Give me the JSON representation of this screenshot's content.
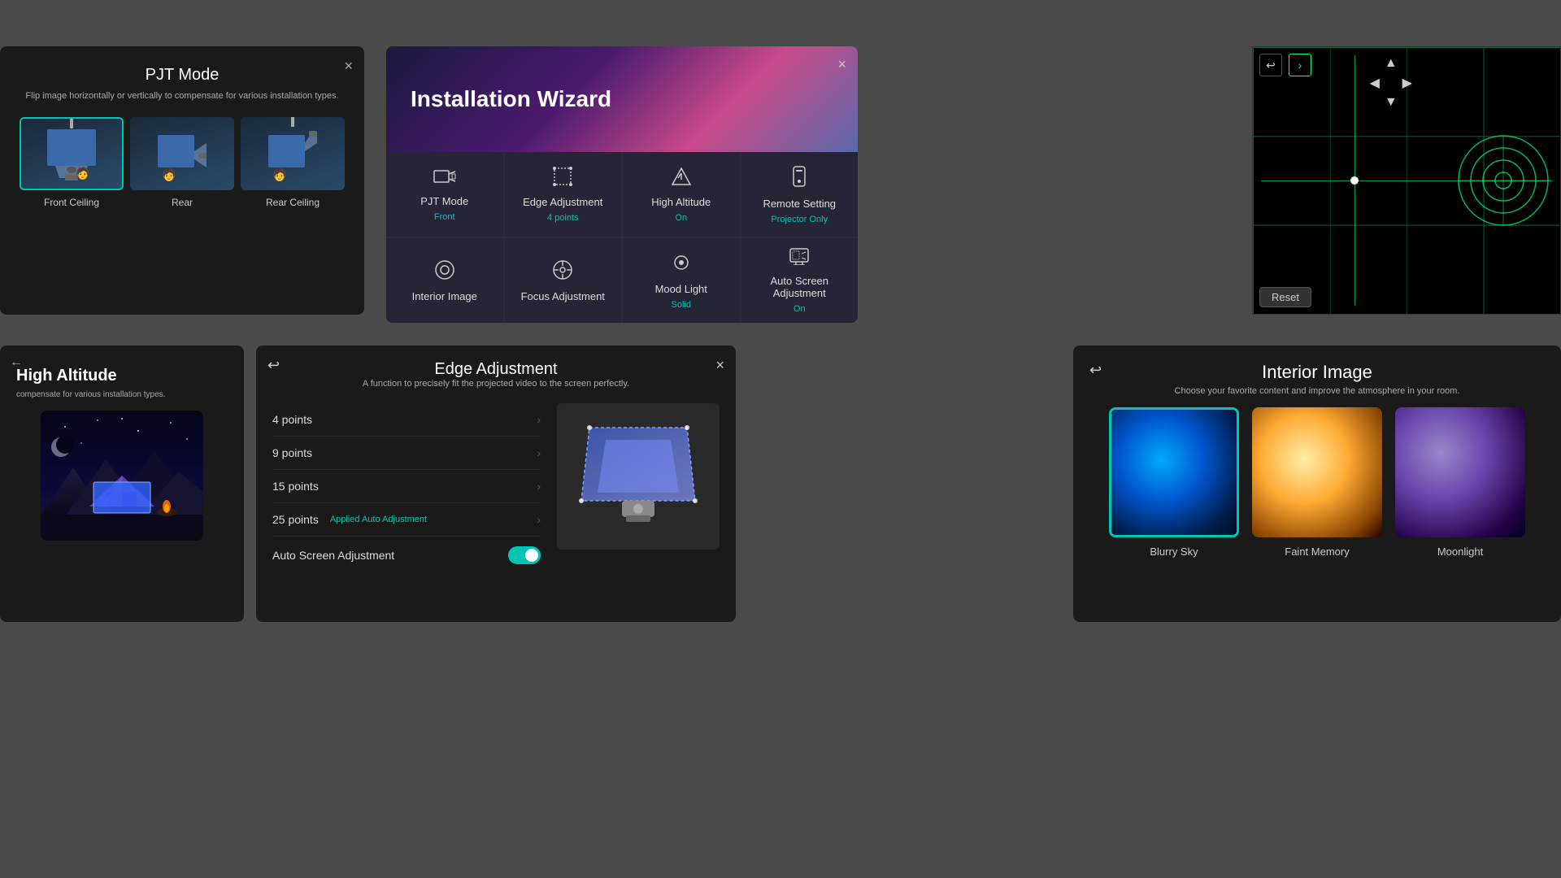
{
  "pjt": {
    "title": "PJT Mode",
    "subtitle": "Flip image horizontally or vertically to compensate for various installation types.",
    "modes": [
      {
        "id": "front-ceiling",
        "label": "Front Ceiling"
      },
      {
        "id": "rear",
        "label": "Rear"
      },
      {
        "id": "rear-ceiling",
        "label": "Rear Ceiling"
      }
    ],
    "close_label": "×"
  },
  "wizard": {
    "title": "Installation Wizard",
    "close_label": "×",
    "items": [
      {
        "id": "pjt-mode",
        "label": "PJT Mode",
        "sub": "Front",
        "icon": "⬜"
      },
      {
        "id": "edge-adjustment",
        "label": "Edge Adjustment",
        "sub": "4 points",
        "icon": "⧉"
      },
      {
        "id": "high-altitude",
        "label": "High Altitude",
        "sub": "On",
        "icon": "❄"
      },
      {
        "id": "remote-setting",
        "label": "Remote Setting",
        "sub": "Projector Only",
        "icon": "📱"
      },
      {
        "id": "interior-image",
        "label": "Interior Image",
        "sub": "",
        "icon": "◯"
      },
      {
        "id": "focus-adjustment",
        "label": "Focus Adjustment",
        "sub": "",
        "icon": "⊕"
      },
      {
        "id": "mood-light",
        "label": "Mood Light",
        "sub": "Solid",
        "icon": "◯"
      },
      {
        "id": "auto-screen",
        "label": "Auto Screen Adjustment",
        "sub": "On",
        "icon": "⊡"
      }
    ]
  },
  "focus": {
    "reset_label": "Reset",
    "back_label": "←",
    "next_label": "→",
    "up_label": "↑",
    "down_label": "↓",
    "left_label": "←",
    "right_label": "→"
  },
  "altitude": {
    "title": "Altitude",
    "prefix": "High ",
    "subtitle": "compensate for various installation types.",
    "close_label": "×",
    "back_label": "←"
  },
  "edge": {
    "title": "Edge Adjustment",
    "subtitle": "A function to precisely fit the projected video to the screen perfectly.",
    "back_label": "↩",
    "close_label": "×",
    "options": [
      {
        "id": "4-points",
        "label": "4 points",
        "badge": "",
        "arrow": "›"
      },
      {
        "id": "9-points",
        "label": "9 points",
        "badge": "",
        "arrow": "›"
      },
      {
        "id": "15-points",
        "label": "15 points",
        "badge": "",
        "arrow": "›"
      },
      {
        "id": "25-points",
        "label": "25 points",
        "badge": "Applied Auto Adjustment",
        "arrow": "›"
      },
      {
        "id": "auto-screen",
        "label": "Auto Screen Adjustment",
        "badge": "",
        "arrow": ""
      }
    ],
    "toggle_on": true
  },
  "interior": {
    "title": "Interior Image",
    "subtitle": "Choose your favorite content and improve the atmosphere in your room.",
    "back_label": "↩",
    "images": [
      {
        "id": "blurry-sky",
        "label": "Blurry Sky",
        "selected": true
      },
      {
        "id": "faint-memory",
        "label": "Faint Memory",
        "selected": false
      },
      {
        "id": "moonlight",
        "label": "Moonlight",
        "selected": false
      }
    ]
  }
}
